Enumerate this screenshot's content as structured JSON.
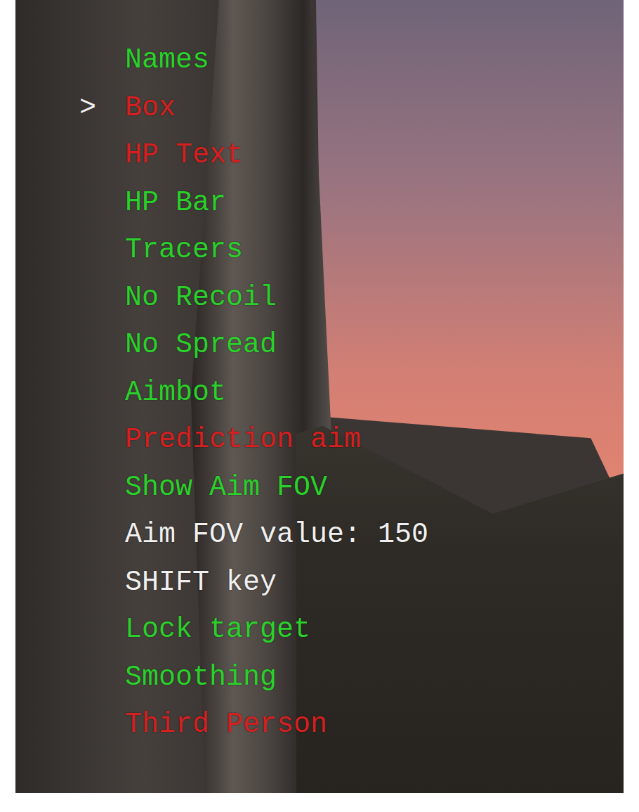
{
  "menu": {
    "cursor": ">",
    "items": [
      {
        "label": "Names",
        "kind": "toggle",
        "on": true,
        "selected": false
      },
      {
        "label": "Box",
        "kind": "toggle",
        "on": false,
        "selected": true
      },
      {
        "label": "HP Text",
        "kind": "toggle",
        "on": false,
        "selected": false
      },
      {
        "label": "HP Bar",
        "kind": "toggle",
        "on": true,
        "selected": false
      },
      {
        "label": "Tracers",
        "kind": "toggle",
        "on": true,
        "selected": false
      },
      {
        "label": "No Recoil",
        "kind": "toggle",
        "on": true,
        "selected": false
      },
      {
        "label": "No Spread",
        "kind": "toggle",
        "on": true,
        "selected": false
      },
      {
        "label": "Aimbot",
        "kind": "toggle",
        "on": true,
        "selected": false
      },
      {
        "label": "Prediction aim",
        "kind": "toggle",
        "on": false,
        "selected": false
      },
      {
        "label": "Show Aim FOV",
        "kind": "toggle",
        "on": true,
        "selected": false
      },
      {
        "label": "Aim FOV value: 150",
        "kind": "value",
        "selected": false
      },
      {
        "label": "SHIFT key",
        "kind": "value",
        "selected": false
      },
      {
        "label": "Lock target",
        "kind": "toggle",
        "on": true,
        "selected": false
      },
      {
        "label": "Smoothing",
        "kind": "toggle",
        "on": true,
        "selected": false
      },
      {
        "label": "Third Person",
        "kind": "toggle",
        "on": false,
        "selected": false
      }
    ]
  }
}
